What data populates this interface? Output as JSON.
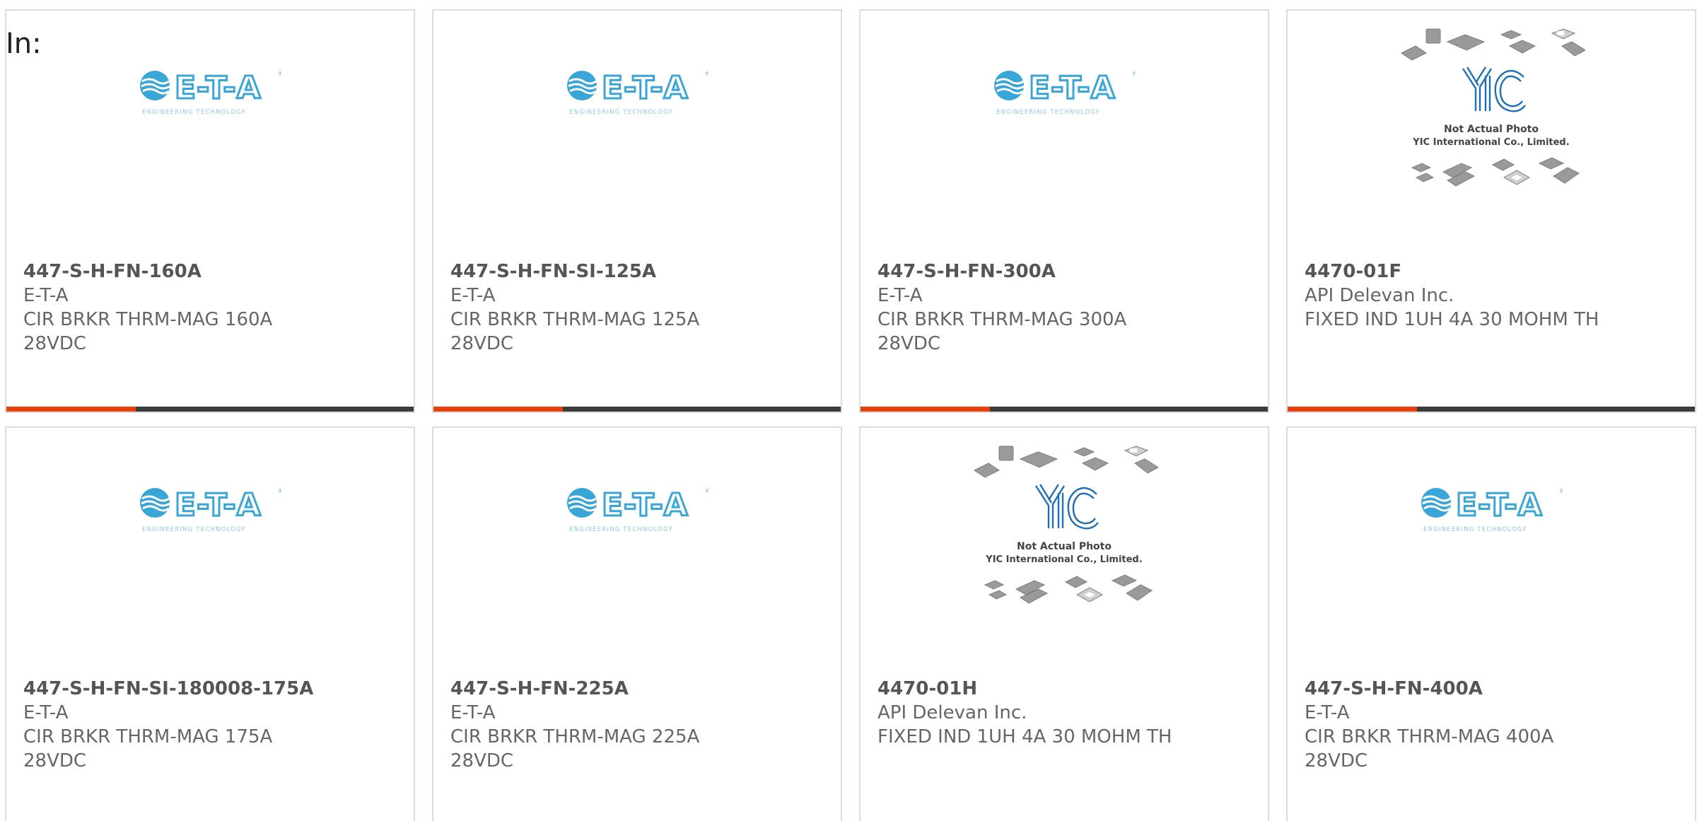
{
  "heading": "In:",
  "colors": {
    "accent_bar": "#e8400c",
    "dark_bar": "#3c3c3c",
    "eta_blue": "#3aa6d8",
    "yic_blue": "#1e6fb4",
    "text": "#666666"
  },
  "eta_logo": {
    "wordmark": "E-T-A",
    "tagline": "ENGINEERING TECHNOLOGY",
    "icon": "eta-globe-icon"
  },
  "yic_logo": {
    "wordmark": "YIC",
    "line1": "Not Actual Photo",
    "line2": "YIC International Co., Limited.",
    "icon": "chip-cluster-icon"
  },
  "products": [
    {
      "part_number": "447-S-H-FN-160A",
      "manufacturer": "E-T-A",
      "description": "CIR BRKR THRM-MAG 160A\n28VDC",
      "image": "eta"
    },
    {
      "part_number": "447-S-H-FN-SI-125A",
      "manufacturer": "E-T-A",
      "description": "CIR BRKR THRM-MAG 125A\n28VDC",
      "image": "eta"
    },
    {
      "part_number": "447-S-H-FN-300A",
      "manufacturer": "E-T-A",
      "description": "CIR BRKR THRM-MAG 300A\n28VDC",
      "image": "eta"
    },
    {
      "part_number": "4470-01F",
      "manufacturer": "API Delevan Inc.",
      "description": "FIXED IND 1UH 4A 30 MOHM TH",
      "image": "yic"
    },
    {
      "part_number": "447-S-H-FN-SI-180008-175A",
      "manufacturer": "E-T-A",
      "description": "CIR BRKR THRM-MAG 175A\n28VDC",
      "image": "eta"
    },
    {
      "part_number": "447-S-H-FN-225A",
      "manufacturer": "E-T-A",
      "description": "CIR BRKR THRM-MAG 225A\n28VDC",
      "image": "eta"
    },
    {
      "part_number": "4470-01H",
      "manufacturer": "API Delevan Inc.",
      "description": "FIXED IND 1UH 4A 30 MOHM TH",
      "image": "yic"
    },
    {
      "part_number": "447-S-H-FN-400A",
      "manufacturer": "E-T-A",
      "description": "CIR BRKR THRM-MAG 400A\n28VDC",
      "image": "eta"
    }
  ]
}
